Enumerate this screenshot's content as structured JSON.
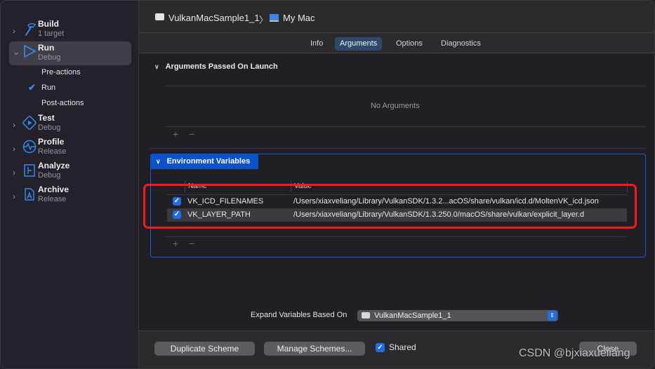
{
  "sidebar": {
    "actions": [
      {
        "title": "Build",
        "subtitle": "1 target",
        "icon": "hammer-icon",
        "expanded": false
      },
      {
        "title": "Run",
        "subtitle": "Debug",
        "icon": "run-play-icon",
        "expanded": true,
        "selected": true
      },
      {
        "title": "Test",
        "subtitle": "Debug",
        "icon": "test-diamond-icon",
        "expanded": false
      },
      {
        "title": "Profile",
        "subtitle": "Release",
        "icon": "profile-waveform-icon",
        "expanded": false
      },
      {
        "title": "Analyze",
        "subtitle": "Debug",
        "icon": "analyze-icon",
        "expanded": false
      },
      {
        "title": "Archive",
        "subtitle": "Release",
        "icon": "archive-icon",
        "expanded": false
      }
    ],
    "run_subitems": [
      {
        "label": "Pre-actions",
        "checked": false
      },
      {
        "label": "Run",
        "checked": true
      },
      {
        "label": "Post-actions",
        "checked": false
      }
    ]
  },
  "header": {
    "scheme": "VulkanMacSample1_1",
    "separator": "〉",
    "destination": "My Mac"
  },
  "tabs": [
    {
      "label": "Info",
      "active": false
    },
    {
      "label": "Arguments",
      "active": true
    },
    {
      "label": "Options",
      "active": false
    },
    {
      "label": "Diagnostics",
      "active": false
    }
  ],
  "arguments": {
    "title": "Arguments Passed On Launch",
    "empty_text": "No Arguments",
    "add_label": "+",
    "remove_label": "−"
  },
  "env": {
    "title": "Environment Variables",
    "columns": {
      "name": "Name",
      "value": "Value"
    },
    "rows": [
      {
        "enabled": true,
        "name": "VK_ICD_FILENAMES",
        "value": "/Users/xiaxveliang/Library/VulkanSDK/1.3.2...acOS/share/vulkan/icd.d/MoltenVK_icd.json"
      },
      {
        "enabled": true,
        "name": "VK_LAYER_PATH",
        "value": "/Users/xiaxveliang/Library/VulkanSDK/1.3.250.0/macOS/share/vulkan/explicit_layer.d"
      }
    ],
    "add_label": "+",
    "remove_label": "−"
  },
  "expand": {
    "label": "Expand Variables Based On",
    "selected": "VulkanMacSample1_1"
  },
  "footer": {
    "duplicate_label": "Duplicate Scheme",
    "manage_label": "Manage Schemes...",
    "shared_label": "Shared",
    "shared_checked": true,
    "close_label": "Close"
  },
  "watermark": "CSDN @bjxiaxueliang",
  "colors": {
    "accent": "#1f6ee8",
    "section_highlight": "#0b52cc",
    "annotation_red": "#f11d1d"
  }
}
